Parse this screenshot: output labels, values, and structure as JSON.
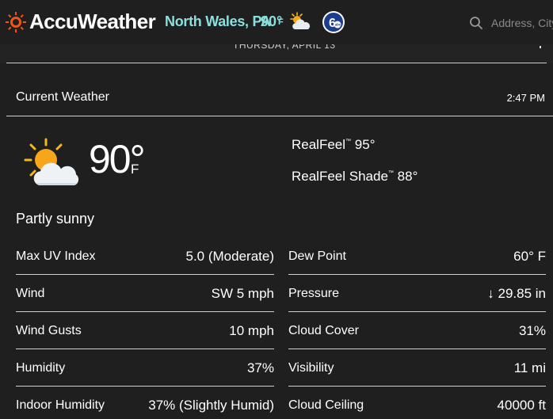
{
  "header": {
    "brand": "AccuWeather",
    "location": "North Wales, PA",
    "temp": "90°",
    "temp_unit": "F",
    "weather_icon": "partly-sunny-icon",
    "partner_logo": "6abc-logo",
    "search_placeholder": "Address, City"
  },
  "banner": {
    "date_text": "THURSDAY, APRIL 13"
  },
  "current": {
    "title": "Current Weather",
    "time": "2:47 PM",
    "temperature": "90°",
    "unit": "F",
    "icon": "partly-sunny-icon",
    "realfeel_label": "RealFeel",
    "realfeel_value": "95°",
    "realfeel_shade_label": "RealFeel Shade",
    "realfeel_shade_value": "88°",
    "trademark": "™",
    "phrase": "Partly sunny"
  },
  "details_left": [
    {
      "label": "Max UV Index",
      "value": "5.0 (Moderate)"
    },
    {
      "label": "Wind",
      "value": "SW 5 mph"
    },
    {
      "label": "Wind Gusts",
      "value": "10 mph"
    },
    {
      "label": "Humidity",
      "value": "37%"
    },
    {
      "label": "Indoor Humidity",
      "value": "37% (Slightly Humid)"
    }
  ],
  "details_right": [
    {
      "label": "Dew Point",
      "value": "60° F"
    },
    {
      "label": "Pressure",
      "value": "↓ 29.85 in"
    },
    {
      "label": "Cloud Cover",
      "value": "31%"
    },
    {
      "label": "Visibility",
      "value": "11 mi"
    },
    {
      "label": "Cloud Ceiling",
      "value": "40000 ft"
    }
  ],
  "colors": {
    "background": "#1f1f1f",
    "brand_orange": "#f05514",
    "location_teal": "#8be0dd",
    "divider": "#d0d0d0"
  }
}
